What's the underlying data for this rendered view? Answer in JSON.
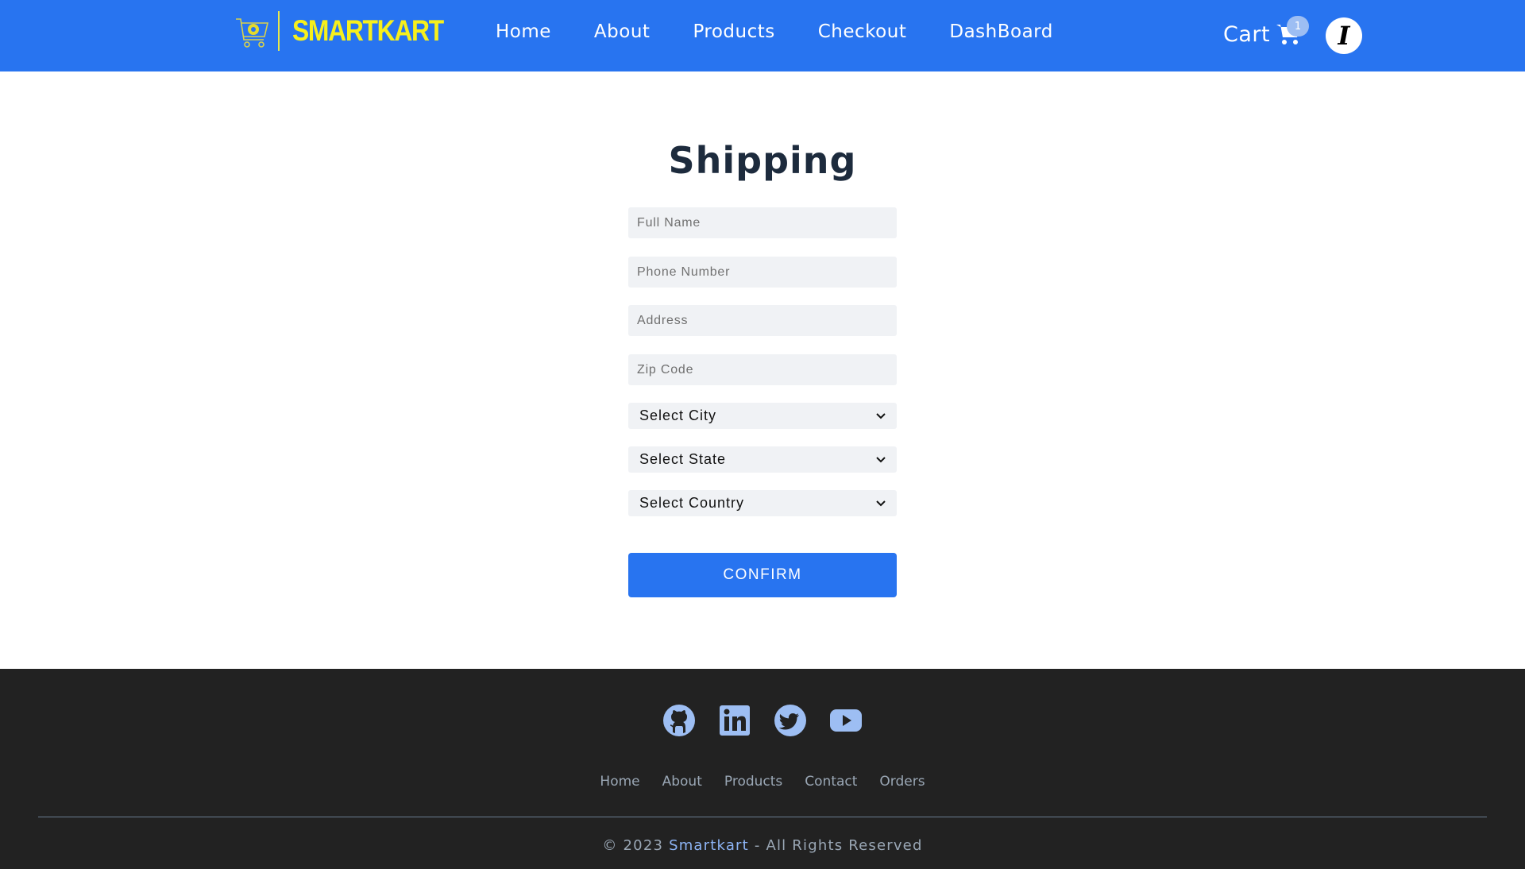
{
  "brand": {
    "name": "SMARTKART",
    "logo_icon": "shopping-cart-logo-icon",
    "text_color": "#f7f01c"
  },
  "nav": {
    "background": "#2874f0",
    "links": [
      "Home",
      "About",
      "Products",
      "Checkout",
      "DashBoard"
    ],
    "cart_label": "Cart",
    "cart_icon": "shopping-cart-icon",
    "cart_count": "1",
    "avatar_letter": "I"
  },
  "form": {
    "title": "Shipping",
    "fields": {
      "full_name": "Full Name",
      "phone": "Phone Number",
      "address": "Address",
      "zip": "Zip Code"
    },
    "selects": {
      "city": "Select City",
      "state": "Select State",
      "country": "Select Country"
    },
    "confirm_label": "CONFIRM"
  },
  "footer": {
    "social_icons": [
      "github-icon",
      "linkedin-icon",
      "twitter-icon",
      "youtube-icon"
    ],
    "links": [
      "Home",
      "About",
      "Products",
      "Contact",
      "Orders"
    ],
    "copyright_prefix": "© 2023",
    "copyright_brand": "Smartkart",
    "copyright_suffix": "- All Rights Reserved"
  }
}
